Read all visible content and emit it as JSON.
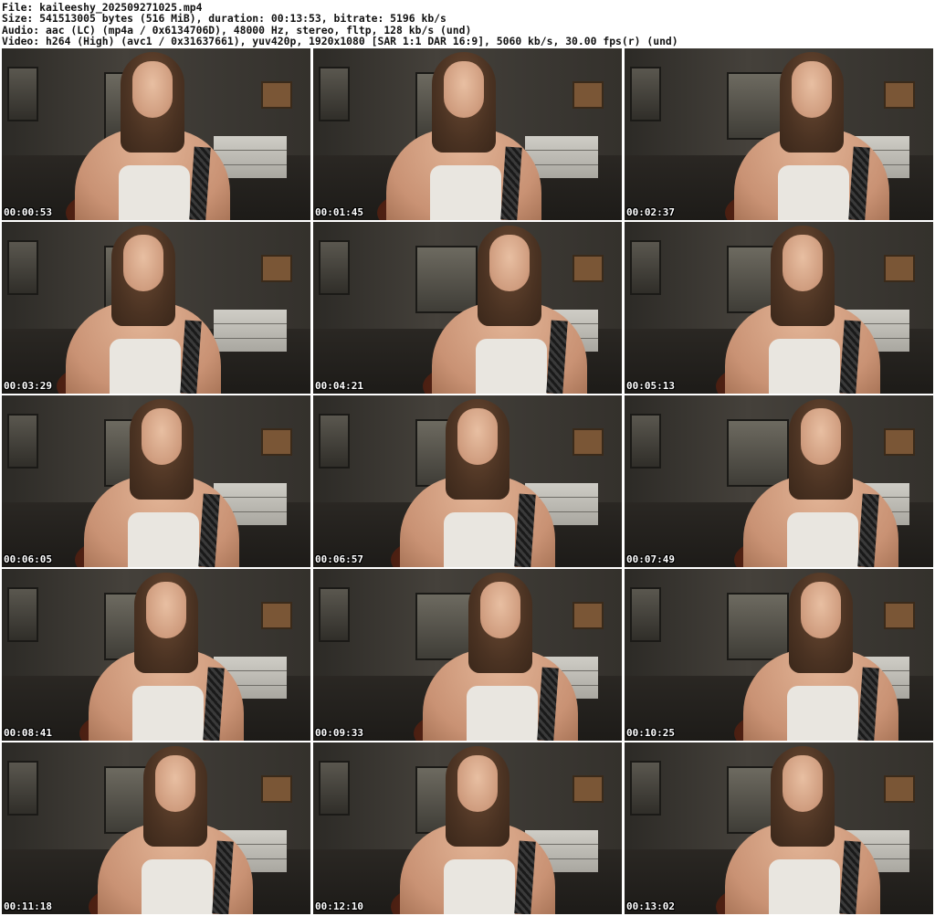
{
  "header": {
    "file": "File: kaileeshy_202509271025.mp4",
    "size": "Size: 541513005 bytes (516 MiB), duration: 00:13:53, bitrate: 5196 kb/s",
    "audio": "Audio: aac (LC) (mp4a / 0x6134706D), 48000 Hz, stereo, fltp, 128 kb/s (und)",
    "video": "Video: h264 (High) (avc1 / 0x31637661), yuv420p, 1920x1080 [SAR 1:1 DAR 16:9], 5060 kb/s, 30.00 fps(r) (und)"
  },
  "thumbnails": [
    {
      "timestamp": "00:00:53"
    },
    {
      "timestamp": "00:01:45"
    },
    {
      "timestamp": "00:02:37"
    },
    {
      "timestamp": "00:03:29"
    },
    {
      "timestamp": "00:04:21"
    },
    {
      "timestamp": "00:05:13"
    },
    {
      "timestamp": "00:06:05"
    },
    {
      "timestamp": "00:06:57"
    },
    {
      "timestamp": "00:07:49"
    },
    {
      "timestamp": "00:08:41"
    },
    {
      "timestamp": "00:09:33"
    },
    {
      "timestamp": "00:10:25"
    },
    {
      "timestamp": "00:11:18"
    },
    {
      "timestamp": "00:12:10"
    },
    {
      "timestamp": "00:13:02"
    }
  ]
}
